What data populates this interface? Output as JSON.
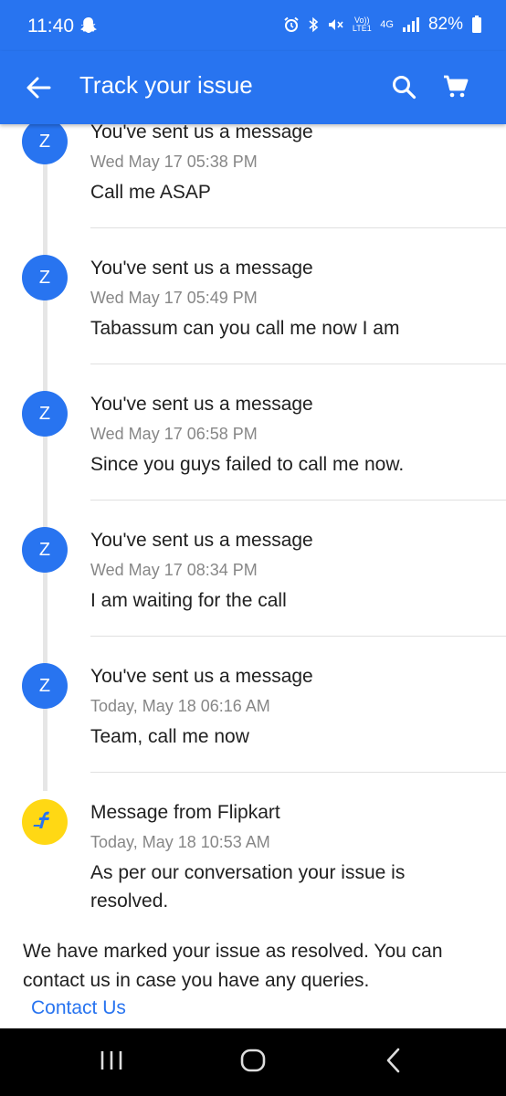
{
  "status_bar": {
    "time": "11:40",
    "battery": "82%",
    "network_top": "4G",
    "volte": "Vo)) LTE1"
  },
  "app_bar": {
    "title": "Track your issue",
    "back_icon": "arrow-left-icon",
    "search_icon": "search-icon",
    "cart_icon": "cart-icon",
    "color": "#2874f0"
  },
  "timeline": [
    {
      "avatar": "Z",
      "heading": "You've sent us a message",
      "date": "Wed May 17 05:38 PM",
      "body": "Call me ASAP"
    },
    {
      "avatar": "Z",
      "heading": "You've sent us a message",
      "date": "Wed May 17 05:49 PM",
      "body": "Tabassum can you call me now I am"
    },
    {
      "avatar": "Z",
      "heading": "You've sent us a message",
      "date": "Wed May 17 06:58 PM",
      "body": "Since you guys failed to call me now."
    },
    {
      "avatar": "Z",
      "heading": "You've sent us a message",
      "date": "Wed May 17 08:34 PM",
      "body": "I am waiting for the call"
    },
    {
      "avatar": "Z",
      "heading": "You've sent us a message",
      "date": "Today, May 18 06:16 AM",
      "body": "Team, call me now"
    },
    {
      "avatar": "flipkart-logo-icon",
      "heading": "Message from Flipkart",
      "date": "Today, May 18 10:53 AM",
      "body": "As per our conversation your issue is resolved."
    }
  ],
  "footer": {
    "resolved_text": "We have marked your issue as resolved. You can contact us in case you have any queries.",
    "contact_link": "Contact Us"
  },
  "nav_bar": {
    "recents_icon": "recents-icon",
    "home_icon": "home-icon",
    "back_icon": "back-chevron-icon"
  }
}
